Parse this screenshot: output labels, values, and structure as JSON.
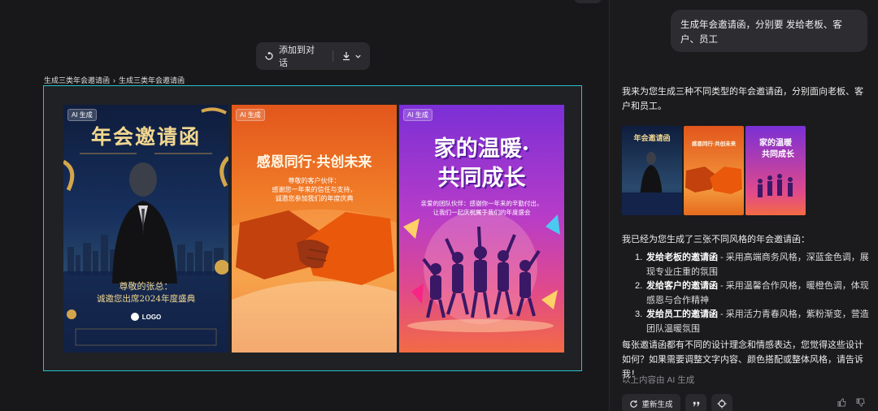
{
  "toolbar": {
    "add_label": "添加到对话"
  },
  "breadcrumb": {
    "parent": "生成三类年会邀请函",
    "separator": "›",
    "current": "生成三类年会邀请函"
  },
  "posters": [
    {
      "tag": "AI 生成",
      "title": "年会邀请函",
      "greeting": "尊敬的张总：",
      "body": "诚邀您出席2024年度盛典",
      "logo": "LOGO"
    },
    {
      "tag": "AI 生成",
      "title": "感恩同行·共创未来",
      "greeting": "尊敬的客户伙伴：",
      "body_line1": "感谢您一年来的信任与支持，",
      "body_line2": "诚邀您参加我们的年度庆典"
    },
    {
      "tag": "AI 生成",
      "title_line1": "家的温暖·",
      "title_line2": "共同成长",
      "body_line1": "亲爱的团队伙伴：感谢你一年来的辛勤付出，",
      "body_line2": "让我们一起庆祝属于我们的年度盛会"
    }
  ],
  "chat": {
    "user_message": "生成年会邀请函，分别要 发给老板、客户、员工",
    "reply_intro": "我来为您生成三种不同类型的年会邀请函，分别面向老板、客户和员工。",
    "summary": "我已经为您生成了三张不同风格的年会邀请函：",
    "items": [
      {
        "num": "1.",
        "bold": "发给老板的邀请函",
        "text": " - 采用高端商务风格，深蓝金色调，展现专业庄重的氛围"
      },
      {
        "num": "2.",
        "bold": "发给客户的邀请函",
        "text": " - 采用温馨合作风格，暖橙色调，体现感恩与合作精神"
      },
      {
        "num": "3.",
        "bold": "发给员工的邀请函",
        "text": " - 采用活力青春风格，紫粉渐变，营造团队温暖氛围"
      }
    ],
    "closing": "每张邀请函都有不同的设计理念和情感表达，您觉得这些设计如何？如果需要调整文字内容、颜色搭配或整体风格，请告诉我！",
    "ai_note": "以上内容由 AI 生成",
    "regenerate_label": "重新生成"
  },
  "colors": {
    "frame_border": "#27c2c8",
    "bg": "#1b1b1d",
    "bubble": "#2c2c31"
  }
}
